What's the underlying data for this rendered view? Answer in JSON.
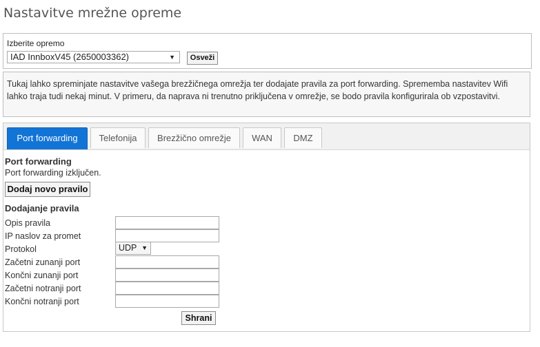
{
  "page_title": "Nastavitve mrežne opreme",
  "device": {
    "label": "Izberite opremo",
    "selected": "IAD InnboxV45 (2650003362)",
    "refresh_label": "Osveži"
  },
  "info_text": "Tukaj lahko spreminjate nastavitve vašega brezžičnega omrežja ter dodajate pravila za port forwarding. Sprememba nastavitev Wifi lahko traja tudi nekaj minut. V primeru, da naprava ni trenutno priključena v omrežje, se bodo pravila konfigurirala ob vzpostavitvi.",
  "tabs": [
    {
      "label": "Port forwarding",
      "active": true
    },
    {
      "label": "Telefonija",
      "active": false
    },
    {
      "label": "Brezžično omrežje",
      "active": false
    },
    {
      "label": "WAN",
      "active": false
    },
    {
      "label": "DMZ",
      "active": false
    }
  ],
  "port_forwarding": {
    "title": "Port forwarding",
    "status": "Port forwarding izključen.",
    "add_button": "Dodaj novo pravilo"
  },
  "form": {
    "title": "Dodajanje pravila",
    "labels": {
      "description": "Opis pravila",
      "ip": "IP naslov za promet",
      "protocol": "Protokol",
      "ext_start": "Začetni zunanji port",
      "ext_end": "Končni zunanji port",
      "int_start": "Začetni notranji port",
      "int_end": "Končni notranji port"
    },
    "values": {
      "description": "",
      "ip": "",
      "ext_start": "",
      "ext_end": "",
      "int_start": "",
      "int_end": ""
    },
    "protocol_selected": "UDP",
    "save_button": "Shrani"
  },
  "colors": {
    "active_tab": "#1274d6",
    "tabbar_bg": "#f1f1f1",
    "info_bg": "#f7f7f7"
  }
}
